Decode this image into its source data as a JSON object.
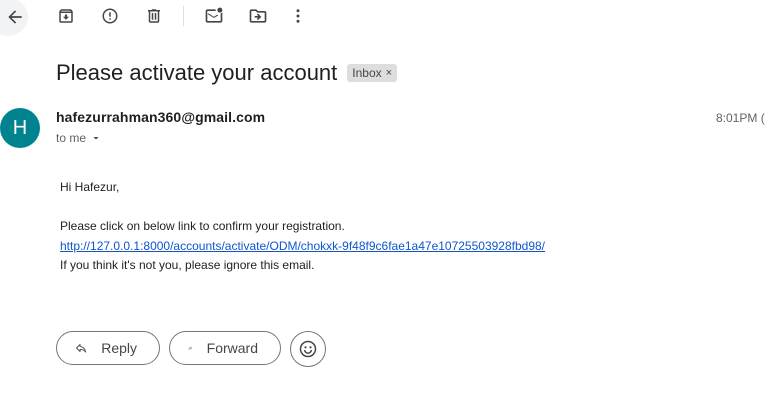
{
  "toolbar": {
    "icons": [
      "back-arrow-icon",
      "archive-icon",
      "report-spam-icon",
      "delete-icon",
      "mark-unread-icon",
      "move-to-icon",
      "more-vert-icon"
    ]
  },
  "email": {
    "subject": "Please activate your account",
    "label": "Inbox",
    "label_remove": "×",
    "avatar_initial": "H",
    "avatar_color": "#00838f",
    "sender": "hafezurrahman360@gmail.com",
    "recipient": "to me",
    "time": "8:01PM (",
    "greeting": "Hi Hafezur,",
    "line1": "Please click on below link to confirm your registration.",
    "link": "http://127.0.0.1:8000/accounts/activate/ODM/chokxk-9f48f9c6fae1a47e10725503928fbd98/",
    "line2": "If you think it's not you, please ignore this email."
  },
  "actions": {
    "reply": "Reply",
    "forward": "Forward",
    "emoji_icon": "emoji-icon"
  },
  "colors": {
    "link": "#1155cc",
    "text": "#1f1f1f"
  }
}
